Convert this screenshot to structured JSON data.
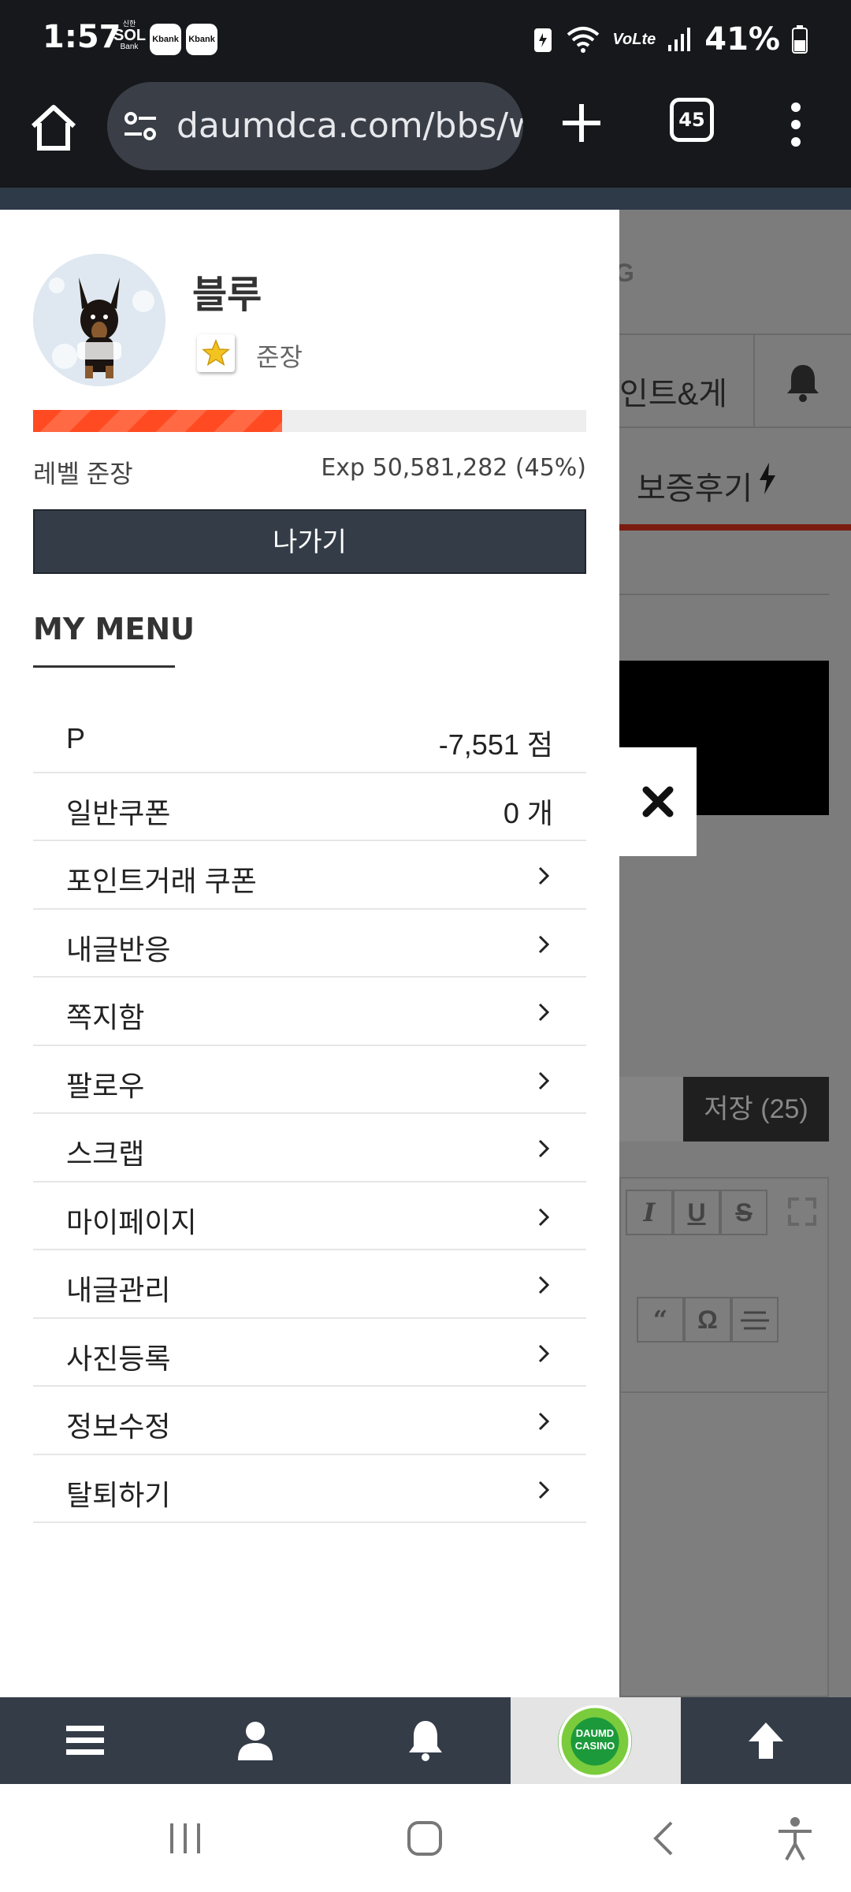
{
  "status_bar": {
    "time": "1:57",
    "sol_small": "신한",
    "sol_main": "SOL",
    "sol_bank": "Bank",
    "kbank_1": "Kbank",
    "kbank_2": "Kbank",
    "volte": "VoLte",
    "battery": "41%"
  },
  "browser": {
    "url": "daumdca.com/bbs/w",
    "tab_count": "45"
  },
  "background_page": {
    "logo_partial": "G",
    "nav_item_1": "인트&게",
    "nav_item_2": "보증후기",
    "save_button": "저장 (25)",
    "editor_tools": [
      "I",
      "U",
      "S",
      "“",
      "Ω"
    ]
  },
  "drawer": {
    "username": "블루",
    "rank": "준장",
    "exp_percent": 45,
    "level_label": "레벨 준장",
    "exp_text": "Exp 50,581,282 (45%)",
    "logout_label": "나가기",
    "menu_title": "MY MENU",
    "points": {
      "label": "P",
      "value": "-7,551 점"
    },
    "coupons": {
      "label": "일반쿠폰",
      "value": "0 개"
    },
    "menu_items": [
      {
        "label": "포인트거래 쿠폰"
      },
      {
        "label": "내글반응"
      },
      {
        "label": "쪽지함"
      },
      {
        "label": "팔로우"
      },
      {
        "label": "스크랩"
      },
      {
        "label": "마이페이지"
      },
      {
        "label": "내글관리"
      },
      {
        "label": "사진등록"
      },
      {
        "label": "정보수정"
      },
      {
        "label": "탈퇴하기"
      }
    ]
  },
  "bottom_nav": {
    "casino_line1": "DAUMD",
    "casino_line2": "CASINO"
  },
  "colors": {
    "drawer_dark": "#343c48",
    "exp_fill": "#ff4a22",
    "dim_overlay": "#7c7c7c"
  }
}
